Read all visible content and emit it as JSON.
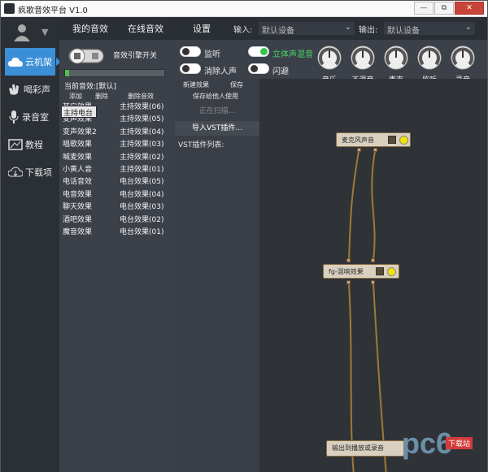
{
  "window": {
    "title": "疯歌音效平台 V1.0",
    "min": "—",
    "restore": "⧉",
    "close": "✕"
  },
  "sidebar": {
    "items": [
      {
        "label": "云机架",
        "icon": "cloud-icon"
      },
      {
        "label": "喝彩声",
        "icon": "clap-icon"
      },
      {
        "label": "录音室",
        "icon": "mic-icon"
      },
      {
        "label": "教程",
        "icon": "tutorial-icon"
      },
      {
        "label": "下载项",
        "icon": "download-cloud-icon"
      }
    ]
  },
  "topbar": {
    "tabs": [
      "我的音效",
      "在线音效",
      "设置"
    ],
    "input_label": "输入:",
    "input_value": "默认设备",
    "output_label": "输出:",
    "output_value": "默认设备"
  },
  "controls": {
    "engine_label": "音效引擎开关",
    "progress": 0.04,
    "toggles": [
      {
        "label": "监听",
        "on": false
      },
      {
        "label": "立体声混音",
        "on": true
      },
      {
        "label": "消除人声",
        "on": false
      },
      {
        "label": "闪避",
        "on": false
      }
    ],
    "knobs": [
      "音乐",
      "不混音",
      "麦克",
      "监听",
      "录音"
    ]
  },
  "effects": {
    "current": "当前音效:[默认]",
    "add": "添加",
    "delete": "删除",
    "delete_effect": "删除音效",
    "list1": [
      "主持电台",
      "其它效果",
      "变声效果",
      "变声效果2",
      "唱歌效果",
      "喊麦效果",
      "小黄人音",
      "电话音效",
      "电音效果",
      "聊天效果",
      "酒吧效果",
      "魔音效果"
    ],
    "list2": [
      "主持效果(06)",
      "主持效果(05)",
      "主持效果(04)",
      "主持效果(03)",
      "主持效果(02)",
      "主持效果(01)",
      "电台效果(05)",
      "电台效果(04)",
      "电台效果(03)",
      "电台效果(02)",
      "电台效果(01)"
    ]
  },
  "vst": {
    "new_effect": "新建效果",
    "save": "保存",
    "save_share": "保存给他人使用",
    "scanning": "正在扫描...",
    "import": "导入VST插件...",
    "list_label": "VST插件列表:"
  },
  "graph": {
    "nodes": [
      "麦克风声音",
      "fg-混响效果",
      "输出到播放或录音"
    ]
  },
  "watermark": {
    "text": "pc6",
    "badge": "下载站"
  }
}
